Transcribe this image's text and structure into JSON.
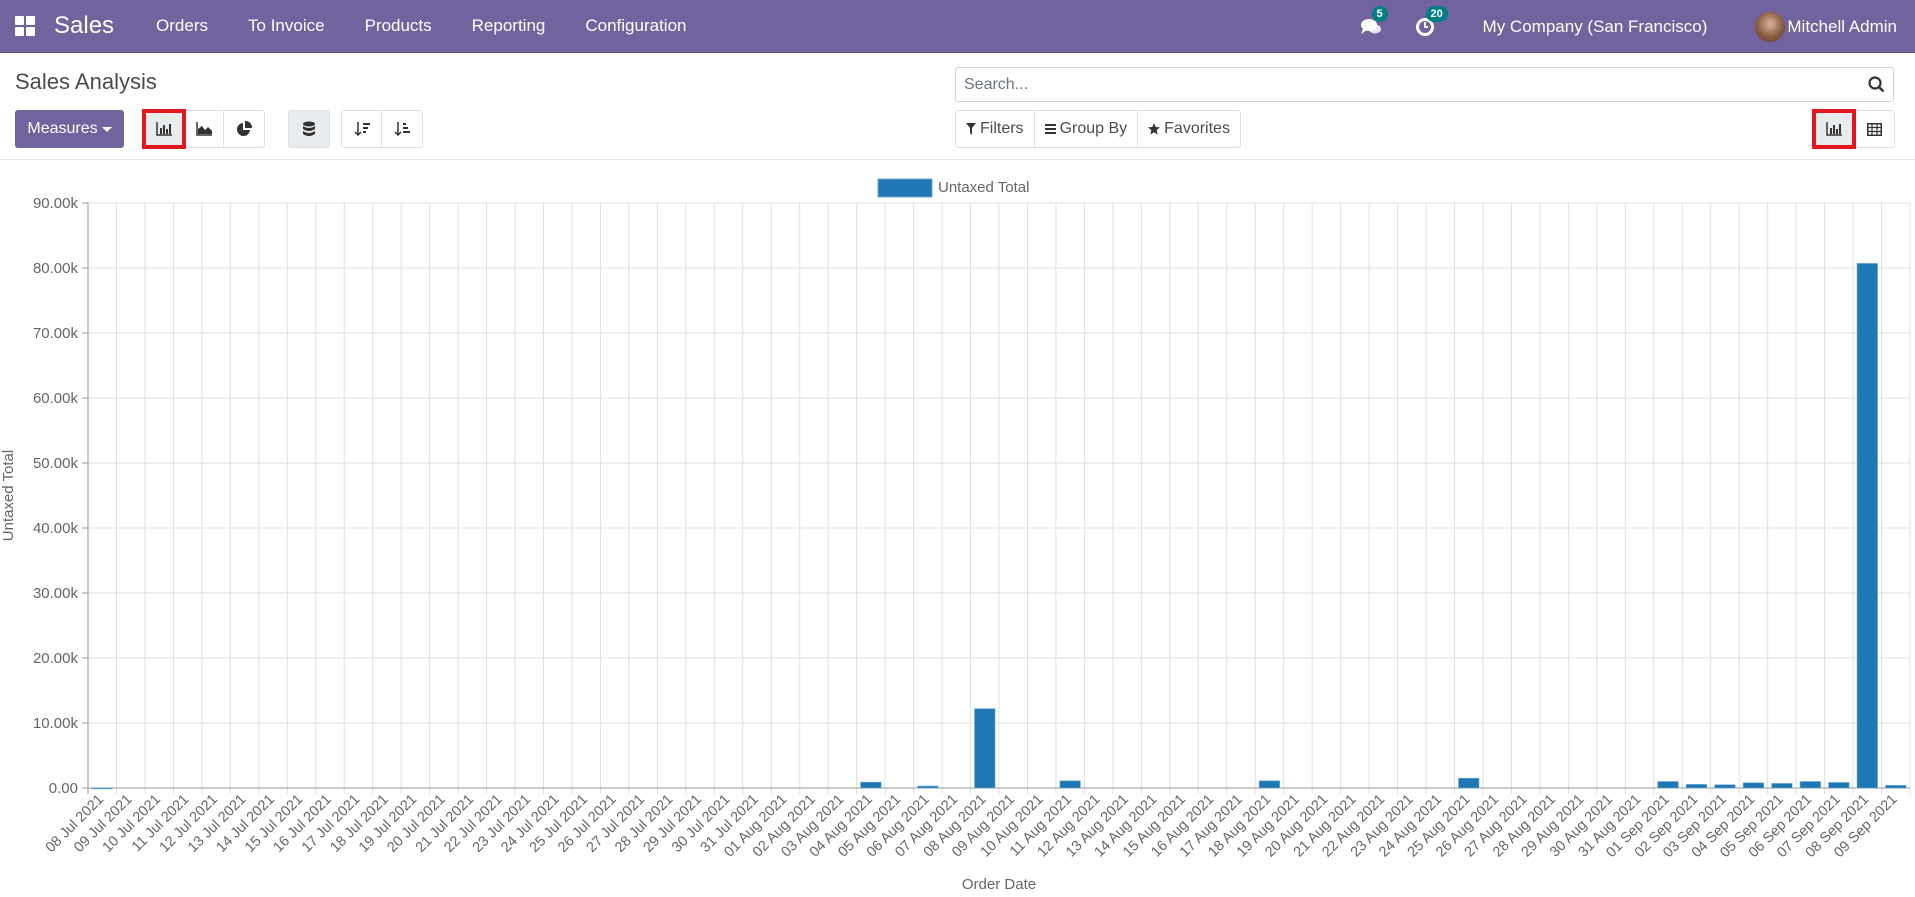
{
  "navbar": {
    "app_name": "Sales",
    "menu": [
      "Orders",
      "To Invoice",
      "Products",
      "Reporting",
      "Configuration"
    ],
    "messages_badge": "5",
    "activities_badge": "20",
    "company": "My Company (San Francisco)",
    "user": "Mitchell Admin",
    "color": "#71639e"
  },
  "control_panel": {
    "title": "Sales Analysis",
    "measures_label": "Measures",
    "search_placeholder": "Search...",
    "filters_label": "Filters",
    "groupby_label": "Group By",
    "favorites_label": "Favorites",
    "chart_modes": [
      "bar-chart-icon",
      "line-chart-icon",
      "pie-chart-icon"
    ],
    "active_chart_mode": "bar",
    "views": [
      "graph-view-icon",
      "pivot-view-icon"
    ],
    "active_view": "graph"
  },
  "chart_data": {
    "type": "bar",
    "title": "",
    "xlabel": "Order Date",
    "ylabel": "Untaxed Total",
    "ylim": [
      0,
      90000
    ],
    "yticks": [
      "0.00",
      "10.00k",
      "20.00k",
      "30.00k",
      "40.00k",
      "50.00k",
      "60.00k",
      "70.00k",
      "80.00k",
      "90.00k"
    ],
    "grid": true,
    "legend": "top-center",
    "bar_color": "#1f77b4",
    "categories": [
      "08 Jul 2021",
      "09 Jul 2021",
      "10 Jul 2021",
      "11 Jul 2021",
      "12 Jul 2021",
      "13 Jul 2021",
      "14 Jul 2021",
      "15 Jul 2021",
      "16 Jul 2021",
      "17 Jul 2021",
      "18 Jul 2021",
      "19 Jul 2021",
      "20 Jul 2021",
      "21 Jul 2021",
      "22 Jul 2021",
      "23 Jul 2021",
      "24 Jul 2021",
      "25 Jul 2021",
      "26 Jul 2021",
      "27 Jul 2021",
      "28 Jul 2021",
      "29 Jul 2021",
      "30 Jul 2021",
      "31 Jul 2021",
      "01 Aug 2021",
      "02 Aug 2021",
      "03 Aug 2021",
      "04 Aug 2021",
      "05 Aug 2021",
      "06 Aug 2021",
      "07 Aug 2021",
      "08 Aug 2021",
      "09 Aug 2021",
      "10 Aug 2021",
      "11 Aug 2021",
      "12 Aug 2021",
      "13 Aug 2021",
      "14 Aug 2021",
      "15 Aug 2021",
      "16 Aug 2021",
      "17 Aug 2021",
      "18 Aug 2021",
      "19 Aug 2021",
      "20 Aug 2021",
      "21 Aug 2021",
      "22 Aug 2021",
      "23 Aug 2021",
      "24 Aug 2021",
      "25 Aug 2021",
      "26 Aug 2021",
      "27 Aug 2021",
      "28 Aug 2021",
      "29 Aug 2021",
      "30 Aug 2021",
      "31 Aug 2021",
      "01 Sep 2021",
      "02 Sep 2021",
      "03 Sep 2021",
      "04 Sep 2021",
      "05 Sep 2021",
      "06 Sep 2021",
      "07 Sep 2021",
      "08 Sep 2021",
      "09 Sep 2021"
    ],
    "series": [
      {
        "name": "Untaxed Total",
        "values": [
          20,
          0,
          0,
          0,
          0,
          0,
          0,
          0,
          0,
          0,
          0,
          0,
          0,
          0,
          0,
          0,
          0,
          0,
          0,
          0,
          0,
          0,
          0,
          0,
          0,
          0,
          0,
          900,
          0,
          300,
          0,
          12200,
          0,
          0,
          1100,
          0,
          0,
          0,
          0,
          0,
          0,
          1100,
          0,
          0,
          0,
          0,
          0,
          0,
          1500,
          0,
          0,
          0,
          0,
          0,
          0,
          1000,
          550,
          500,
          800,
          700,
          1000,
          850,
          80700,
          400
        ]
      }
    ]
  }
}
